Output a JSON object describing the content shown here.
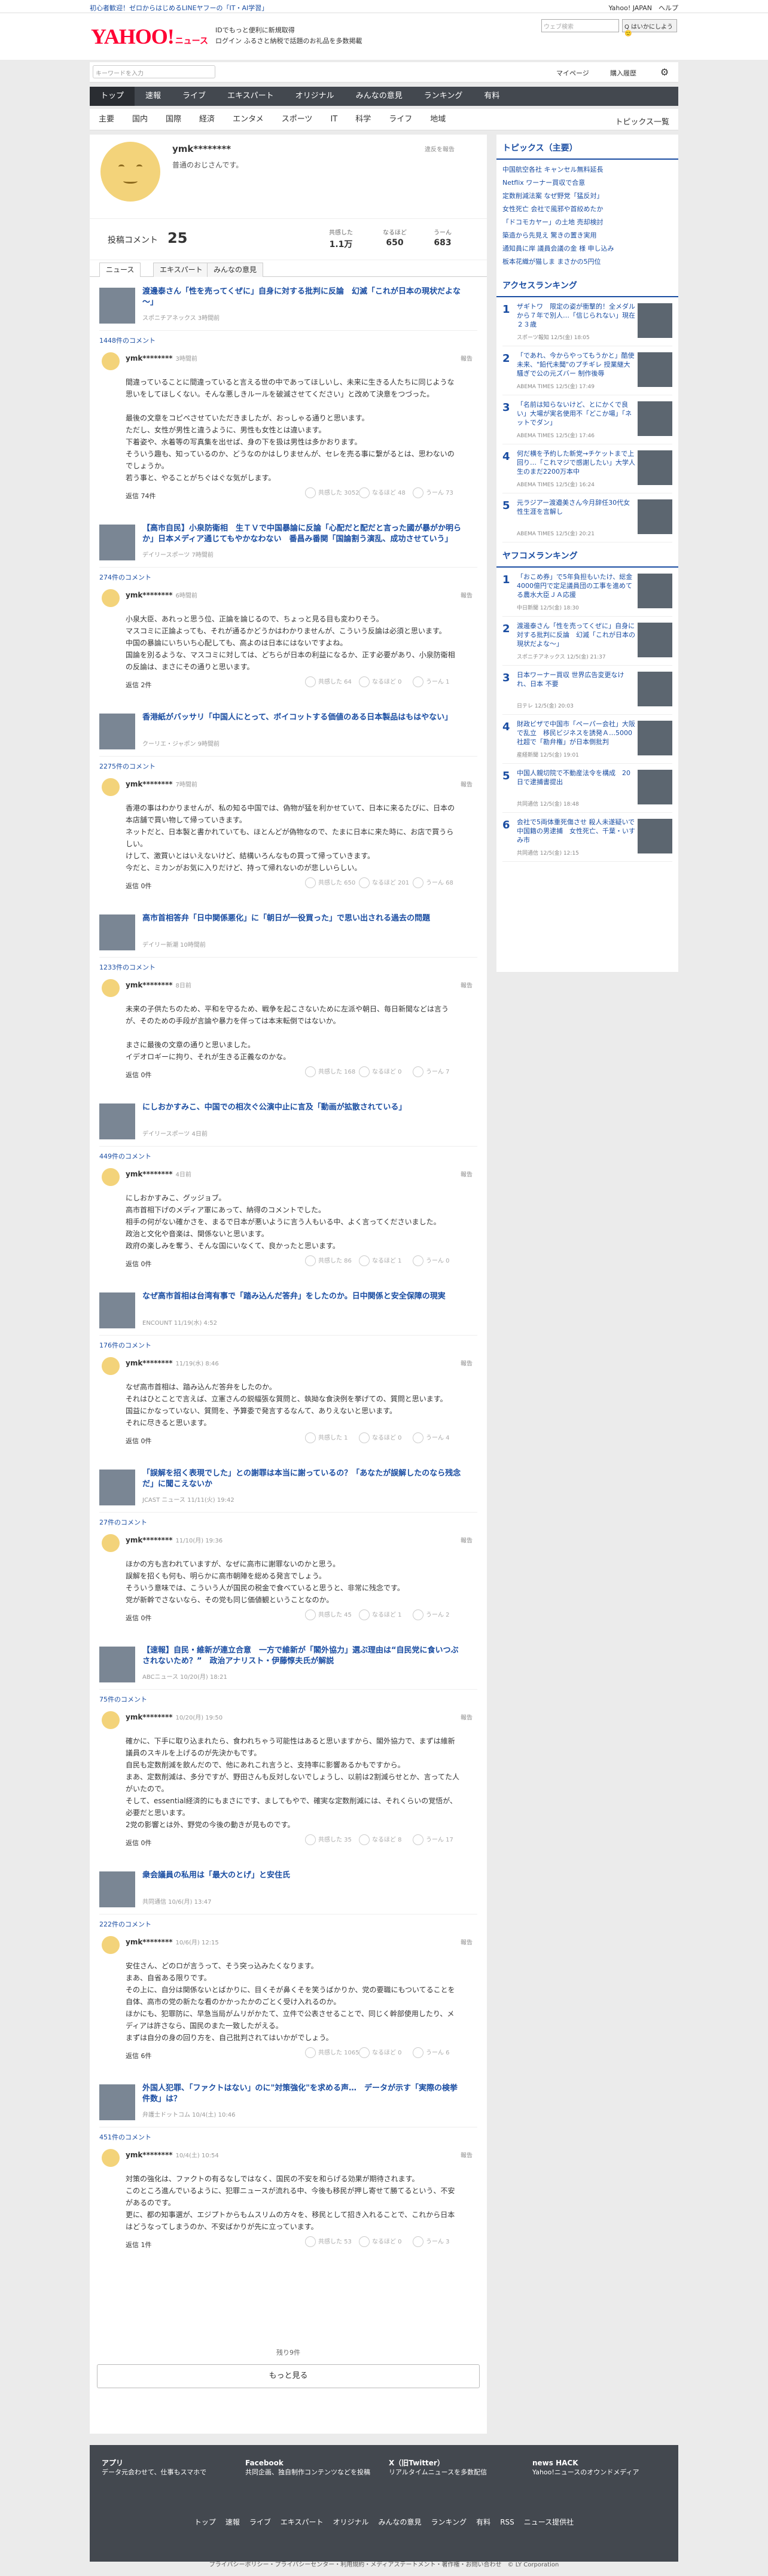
{
  "topstrip": {
    "left": "初心者歓迎！ゼロからはじめるLINEヤフーの「IT・AI学習」",
    "right": "Yahoo! JAPAN　ヘルプ"
  },
  "header": {
    "logo": "YAHOO!",
    "logo_sub": "ニュース",
    "promo1": "IDでもっと便利に新規取得",
    "promo2": "ログイン ふるさと納税で話題のお礼品を多数掲載",
    "search_ph": "ウェブ検索",
    "search_btn": "Q はいかにしよう🙂"
  },
  "toolbar": {
    "search_ph": "キーワードを入力",
    "mypage": "マイページ",
    "buy": "購入履歴"
  },
  "navmain": [
    "トップ",
    "速報",
    "ライブ",
    "エキスパート",
    "オリジナル",
    "みんなの意見",
    "ランキング",
    "有料"
  ],
  "navsub": [
    "主要",
    "国内",
    "国際",
    "経済",
    "エンタメ",
    "スポーツ",
    "IT",
    "科学",
    "ライフ",
    "地域"
  ],
  "navsub_more": "トピックス一覧",
  "profile": {
    "name": "ymk********",
    "desc": "普通のおじさんです。",
    "report": "違反を報告"
  },
  "stats": {
    "label": "投稿コメント",
    "count": "25",
    "s1": "共感した",
    "v1": "1.1万",
    "s2": "なるほど",
    "v2": "650",
    "s3": "うーん",
    "v3": "683"
  },
  "tabs": [
    "ニュース",
    "エキスパート",
    "みんなの意見"
  ],
  "entries": [
    {
      "title": "渡邊泰さん「性を売ってくぜに」自身に対する批判に反論　幻滅「これが日本の現状だよな～」",
      "src": "スポニチアネックス 3時間前",
      "cc": "1448件のコメント",
      "name": "ymk********",
      "time": "3時間前",
      "body": "間違っていることに間違っていると言える世の中であってほしいし、未来に生きる人たちに同じような思いをしてほしくない。そんな悪しきルールを破滅させてください」と改めて決意をつづった。\n\n最後の文章をコピペさせていただきましたが、おっしゃる通りと思います。\nただし、女性が男性と違うように、男性も女性とは違います。\n下着姿や、水着等の写真集を出せば、身の下を扱は男性は多かおります。\nそういう趣も、知っているのか、どうなのかはしりませんが、セレを売る事に繋がるとは、思わないのでしょうか。\n若う事と、やることがちぐはぐな気がします。",
      "rep": "返信 74件",
      "r1": "共感した 3052",
      "r2": "なるほど 48",
      "r3": "うーん 73"
    },
    {
      "title": "【高市自民】小泉防衛相　生ＴＶで中国暴論に反論「心配だと配だと言った國が暴がか明らか」日本メディア通じてもやかなわない　番昌み番関「国論割う演乱、成功させていう」",
      "src": "デイリースポーツ 7時間前",
      "cc": "274件のコメント",
      "name": "ymk********",
      "time": "6時間前",
      "body": "小泉大臣、あれっと思う位、正論を論じるので、ちょっと見る目も変わりそう。\nマスコミに正論よっても、それが通るかどうかはわかりませんが、こういう反論は必須と思います。\n中国の暴論にいちいち心配しても、高よのは日本にはないですよね。\n国論を別るような、マスコミに対しては、どちらが日本の利益になるか、正す必要があり、小泉防衛相の反論は、まさにその通りと思います。",
      "rep": "返信 2件",
      "r1": "共感した 64",
      "r2": "なるほど 0",
      "r3": "うーん 1"
    },
    {
      "title": "香港紙がバッサリ「中国人にとって、ボイコットする価値のある日本製品はもはやない」",
      "src": "クーリエ・ジャポン 9時間前",
      "cc": "2275件のコメント",
      "name": "ymk********",
      "time": "7時間前",
      "body": "香港の事はわかりませんが、私の知る中国では、偽物が猛を利かせていて、日本に来るたびに、日本の本店舗で買い物して帰っていきます。\nネットだと、日本製と書かれていても、ほとんどが偽物なので、たまに日本に来た時に、お店で買うらしい。\nけして、激買いとはいえないけど、結構いろんなもの買って帰っていきます。\n今だと、ミカンがお気に入りだけど、持って帰れないのが悲しいらしい。",
      "rep": "返信 0件",
      "r1": "共感した 650",
      "r2": "なるほど 201",
      "r3": "うーん 68"
    },
    {
      "title": "高市首相答弁「日中関係悪化」に「朝日が一役買った」で思い出される過去の問題",
      "src": "デイリー新潮 10時間前",
      "cc": "1233件のコメント",
      "name": "ymk********",
      "time": "8日前",
      "body": "未来の子供たちのため、平和を守るため、戦争を起こさないために左派や朝日、毎日新聞などは言うが、そのための手段が言論や暴力を伴っては本末転倒ではないか。\n\nまさに最後の文章の通りと思いました。\nイデオロギーに拘り、それが生きる正義なのかな。",
      "rep": "返信 0件",
      "r1": "共感した 168",
      "r2": "なるほど 0",
      "r3": "うーん 7"
    },
    {
      "title": "にしおかすみこ、中国での相次ぐ公演中止に言及「動画が拡散されている」",
      "src": "デイリースポーツ 4日前",
      "cc": "449件のコメント",
      "name": "ymk********",
      "time": "4日前",
      "body": "にしおかすみこ、グッジョブ。\n高市首相下げのメディア軍にあって、納得のコメントでした。\n相手の何がない確かさを、まるで日本が悪いように言う人もいる中、よく言ってくださいました。\n政治と文化や音楽は、関係ないと思います。\n政府の楽しみを奪う、そんな国にいなくて、良かったと思います。",
      "rep": "返信 0件",
      "r1": "共感した 86",
      "r2": "なるほど 1",
      "r3": "うーん 0"
    },
    {
      "title": "なぜ高市首相は台湾有事で「踏み込んだ答弁」をしたのか。日中関係と安全保障の現実",
      "src": "ENCOUNT 11/19(水) 4:52",
      "cc": "176件のコメント",
      "name": "ymk********",
      "time": "11/19(水) 8:46",
      "body": "なぜ高市首相は、踏み込んだ答弁をしたのか。\nそれはひとことで言えば、立憲さんの鋭幅張な質問と、執拗な食決例を挙げての、質問と思います。\n国益にかなっていない、質問を、予算委で発言するなんて、ありえないと思います。\nそれに尽きると思います。",
      "rep": "返信 0件",
      "r1": "共感した 1",
      "r2": "なるほど 0",
      "r3": "うーん 4"
    },
    {
      "title": "「誤解を招く表現でした」との謝罪は本当に謝っているの？「あなたが誤解したのなら残念だ」に聞こえないか",
      "src": "JCAST ニュース 11/11(火) 19:42",
      "cc": "27件のコメント",
      "name": "ymk********",
      "time": "11/10(月) 19:36",
      "body": "ほかの方も言われていますが、なぜに高市に謝罪ないのかと思う。\n誤解を招くも何も、明らかに高市朝陣を総める発言でしょう。\nそういう意味では、こういう人が国民の税金で食べていると思うと、非常に残念です。\n党が新幹でさないなら、その党も同じ価値観ということなのか。",
      "rep": "返信 0件",
      "r1": "共感した 45",
      "r2": "なるほど 1",
      "r3": "うーん 2"
    },
    {
      "title": "【速報】自民・維新が連立合意　一方で維新が「閣外協力」選ぶ理由は“自民党に食いつぶされないため？”　政治アナリスト・伊藤惇夫氏が解説",
      "src": "ABCニュース 10/20(月) 18:21",
      "cc": "75件のコメント",
      "name": "ymk********",
      "time": "10/20(月) 19:50",
      "body": "確かに、下手に取り込まれたら、食われちゃう可能性はあると思いますから、閣外協力で、まずは維新議員のスキルを上げるのが先決かもです。\n自民も定数削減を飲んだので、他にあれこれ言うと、支持率に影響あるかもですから。\nまあ、定数削減は、多分ですが、野田さんも反対しないでしょうし、以前は2割減らせとか、言ってた人がいたので。\nそして、essential経済的にもまさにです、ましてもやで、確実な定数削減には、それくらいの覚悟が、必要だと思います。\n2党の影響とは外、野党の今後の動きが見ものです。",
      "rep": "返信 0件",
      "r1": "共感した 35",
      "r2": "なるほど 8",
      "r3": "うーん 17"
    },
    {
      "title": "衆会議員の私用は「最大のとげ」と安住氏",
      "src": "共同通信 10/6(月) 13:47",
      "cc": "222件のコメント",
      "name": "ymk********",
      "time": "10/6(月) 12:15",
      "body": "安住さん、どのロが言うって、そう突っ込みたくなります。\nまあ、自省ある限りです。\nその上に、自分は関係ないとばかりに、目くそが鼻くそを笑うばかりか、党の要職にもついてることを自体、高市の党の新たな看のかかったかのごとく受け入れるのか。\nほかにも、犯罪防に、早急当局がムリがかたて、立件で公表させることで、同じく幹部使用したり、メディアは許さなら、国民のまた一致したがえる。\nまずは自分の身の回り方を、自己批判されてはいかがでしょう。",
      "rep": "返信 6件",
      "r1": "共感した 1065",
      "r2": "なるほど 0",
      "r3": "うーん 6"
    },
    {
      "title": "外国人犯罪、「ファクトはない」のに\"対策強化\"を求める声…　データが示す「実際の検挙件数」は？",
      "src": "弁護士ドットコム 10/4(土) 10:46",
      "cc": "451件のコメント",
      "name": "ymk********",
      "time": "10/4(土) 10:54",
      "body": "対策の強化は、ファクトの有るなしではなく、国民の不安を和らげる効果が期待されます。\nこのところ進んでいるように、犯罪ニュースが流れる中、今後も移民が押し寄せて勝てるという、不安があるのです。\n更に、都の知事選が、エジプトからもムスリムの方々を、移民として招き入れることで、これから日本はどうなってしまうのか、不安ばかりが先に立っています。",
      "rep": "返信 1件",
      "r1": "共感した 53",
      "r2": "なるほど 0",
      "r3": "うーん 3"
    }
  ],
  "remain": "残り9件",
  "more": "もっと見る",
  "sidebar": {
    "topics_h": "トピックス（主要）",
    "topics": [
      "中国航空各社 キャンセル無料延長",
      "Netflix ワーナー買収で合意",
      "定数削減法案 なぜ野党「猛反対」",
      "女性死亡 会社で風邪や首絞めたか",
      "「ドコモカヤー」の土地 売却検討",
      "築造から先見え 驚きの置き実用",
      "通知員に岸 議員会議の金 様 申し込み",
      "板本花織が猫しま まさかの5円位"
    ],
    "access_h": "アクセスランキング",
    "access": [
      {
        "n": "1",
        "t": "ザギトワ　限定の姿が衝撃的！全メダルから７年で別人…「信じられない」現在２３歳",
        "s": "スポーツ報知 12/5(金) 18:05"
      },
      {
        "n": "2",
        "t": "「であれ、今からやってもうかと」酷使未来、\"鉛代未聞\"のプチギレ 授業継大騒ぎで公の元ズバー 制作後辱",
        "s": "ABEMA TIMES 12/5(金) 17:49"
      },
      {
        "n": "3",
        "t": "「名前は知らないけど、とにかくで良い」大場が実名使用不「どこか場」「ネットでダン」",
        "s": "ABEMA TIMES 12/5(金) 17:46"
      },
      {
        "n": "4",
        "t": "何だ横を予約した新党→チケットまで上回り…「これマジで感謝したい」大学人生のまだ2200万本中",
        "s": "ABEMA TIMES 12/5(金) 16:24"
      },
      {
        "n": "5",
        "t": "元ラジアー渡邉美さん今月辞任30代女性生涯を言解し",
        "s": "ABEMA TIMES 12/5(金) 20:21"
      }
    ],
    "yafo_h": "ヤフコメランキング",
    "yafo": [
      {
        "n": "1",
        "t": "「おこめ券」で5年負担もいたけ、総金4000億円で定足議員団の工事を進めてる農水大臣ＪＡ応援",
        "s": "中日新聞 12/5(金) 18:30"
      },
      {
        "n": "2",
        "t": "渡邊泰さん「性を売ってくぜに」自身に対する批判に反論　幻滅「これが日本の現状だよな～」",
        "s": "スポニチアネックス 12/5(金) 21:37"
      },
      {
        "n": "3",
        "t": "日本ワーナー買収 世界広告変更なけれ、日本 不要",
        "s": "日テレ 12/5(金) 20:03"
      },
      {
        "n": "4",
        "t": "財政ビザで中国市「ペーパー会社」大阪で乱立　移民ビジネスを誘発Ａ…5000社超で「勘弁権」が日本側批判",
        "s": "産経新聞 12/5(金) 19:01"
      },
      {
        "n": "5",
        "t": "中国人親切院で不動産法令を構成　20日で逮捕書提出",
        "s": "共同通信 12/5(金) 18:48"
      },
      {
        "n": "6",
        "t": "会社で5両体重死傷させ 殺人未遂疑いで中国籍の男逮捕　女性死亡、千葉・いすみ市",
        "s": "共同通信 12/5(金) 12:15"
      }
    ]
  },
  "footer": {
    "app_h": "アプリ",
    "app_t": "データ元会わせて、仕事もスマホで",
    "fb_h": "Facebook",
    "fb_t": "共同企画、独自制作コンテンツなどを投稿",
    "x_h": "X（旧Twitter）",
    "x_t": "リアルタイムニュースを多数配信",
    "hack_h": "news HACK",
    "hack_t": "Yahoo!ニュースのオウンドメディア",
    "nav": [
      "トップ",
      "速報",
      "ライブ",
      "エキスパート",
      "オリジナル",
      "みんなの意見",
      "ランキング",
      "有料",
      "RSS",
      "ニュース提供社"
    ]
  },
  "legal": "プライバシーポリシー・プライバシーセンター・利用規約・メディアステートメント・著作権・お問い合わせ　© LY Corporation"
}
